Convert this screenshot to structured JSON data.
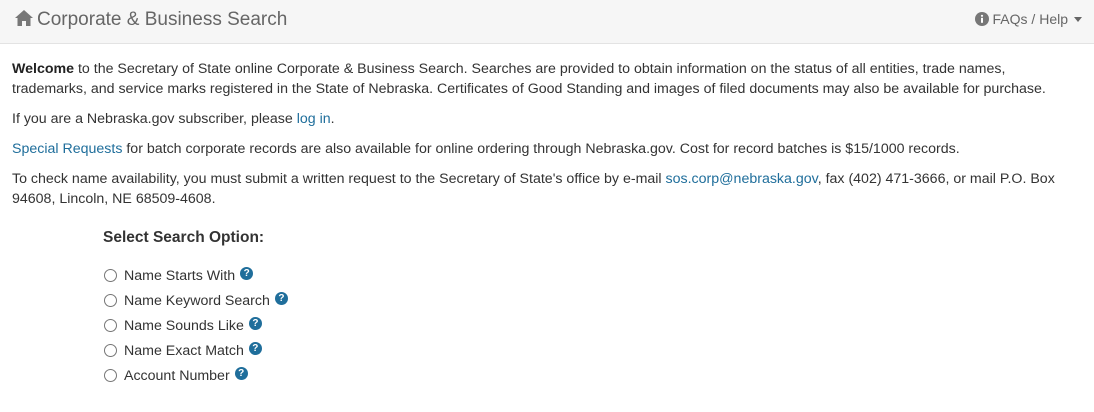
{
  "header": {
    "brand": "Corporate & Business Search",
    "home_icon": "home-icon",
    "help_label": "FAQs / Help",
    "help_icon": "info-circle-icon"
  },
  "intro": {
    "welcome_bold": "Welcome",
    "welcome_text": " to the Secretary of State online Corporate & Business Search. Searches are provided to obtain information on the status of all entities, trade names, trademarks, and service marks registered in the State of Nebraska. Certificates of Good Standing and images of filed documents may also be available for purchase.",
    "subscriber_prefix": "If you are a Nebraska.gov subscriber, please ",
    "login_link": "log in",
    "subscriber_suffix": ".",
    "special_link": "Special Requests",
    "special_text": " for batch corporate records are also available for online ordering through Nebraska.gov. Cost for record batches is $15/1000 records.",
    "check_prefix": "To check name availability, you must submit a written request to the Secretary of State's office by e-mail ",
    "email_link": "sos.corp@nebraska.gov",
    "check_suffix": ", fax (402) 471-3666, or mail P.O. Box 94608, Lincoln, NE 68509-4608."
  },
  "search_options": {
    "title": "Select Search Option:",
    "help_icon_glyph": "?",
    "items": [
      {
        "label": "Name Starts With"
      },
      {
        "label": "Name Keyword Search"
      },
      {
        "label": "Name Sounds Like"
      },
      {
        "label": "Name Exact Match"
      },
      {
        "label": "Account Number"
      }
    ]
  },
  "colors": {
    "link": "#1f6e9b",
    "topbar_bg": "#f6f6f6",
    "text": "#333333"
  }
}
